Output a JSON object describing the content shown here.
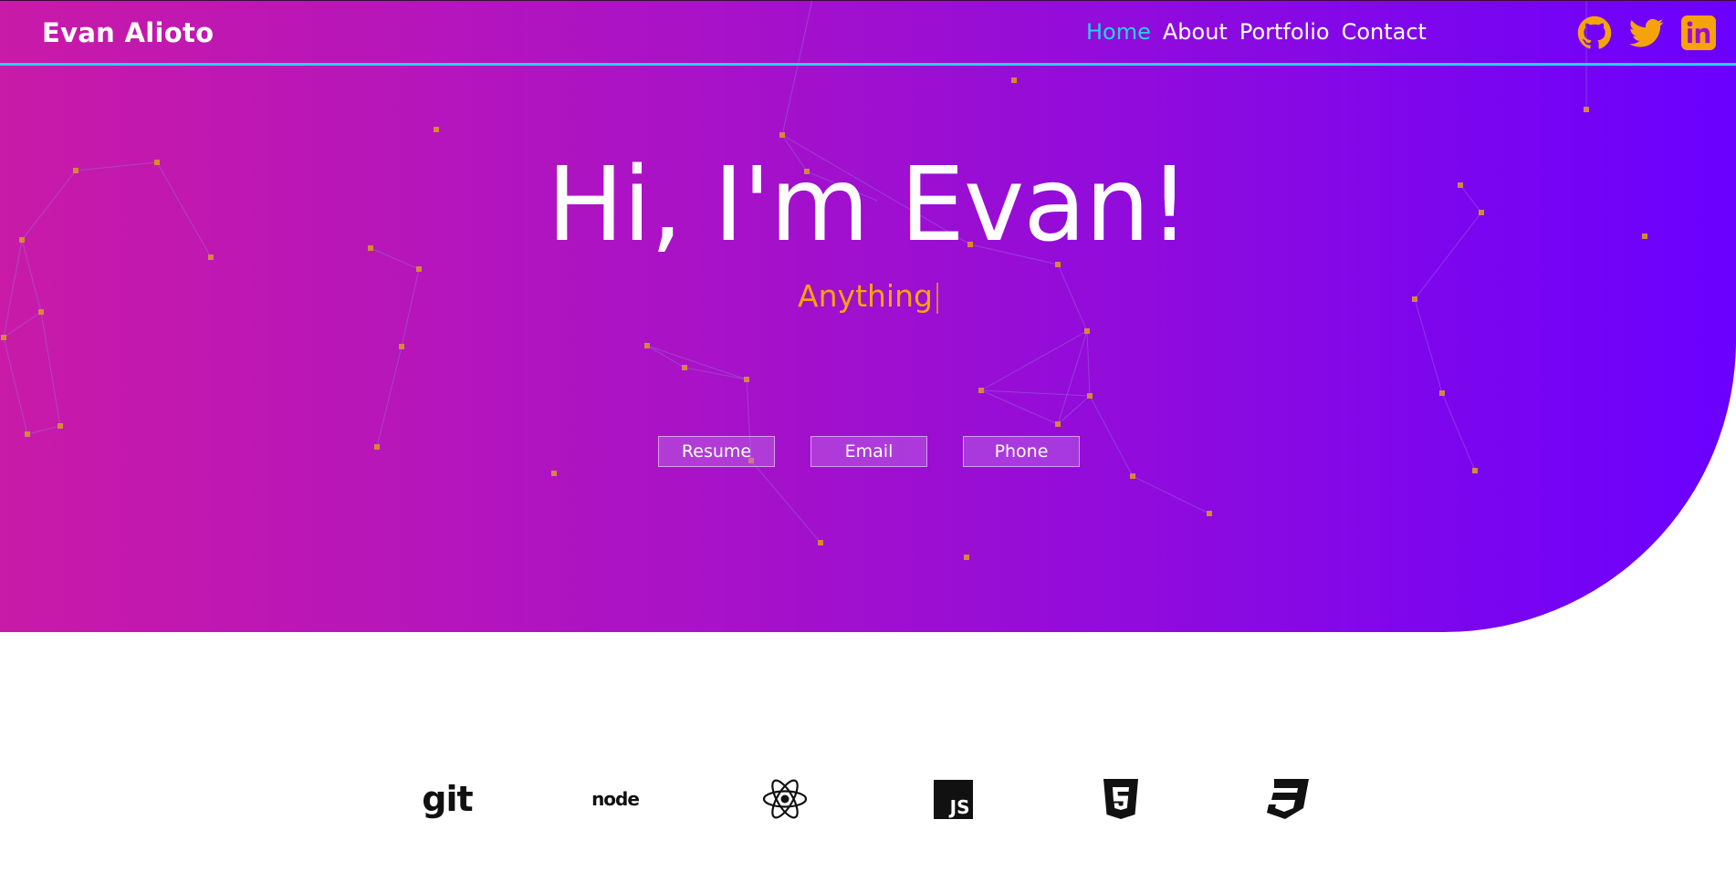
{
  "nav": {
    "brand": "Evan Alioto",
    "links": [
      {
        "label": "Home",
        "active": true
      },
      {
        "label": "About",
        "active": false
      },
      {
        "label": "Portfolio",
        "active": false
      },
      {
        "label": "Contact",
        "active": false
      }
    ],
    "social_icons": [
      "github-icon",
      "twitter-icon",
      "linkedin-icon"
    ],
    "accent_color": "#22d3ee",
    "icon_color": "#f5a30b"
  },
  "hero": {
    "headline": "Hi, I'm Evan!",
    "typed_text": "Anything",
    "buttons": [
      "Resume",
      "Email",
      "Phone"
    ],
    "gradient_colors": [
      "#c91aa8",
      "#6a00ff"
    ]
  },
  "skills": {
    "icons": [
      "git-logo-icon",
      "nodejs-logo-icon",
      "react-logo-icon",
      "javascript-logo-icon",
      "html5-logo-icon",
      "css3-logo-icon"
    ],
    "git_text": "git",
    "node_text": "node",
    "js_text": "JS"
  }
}
